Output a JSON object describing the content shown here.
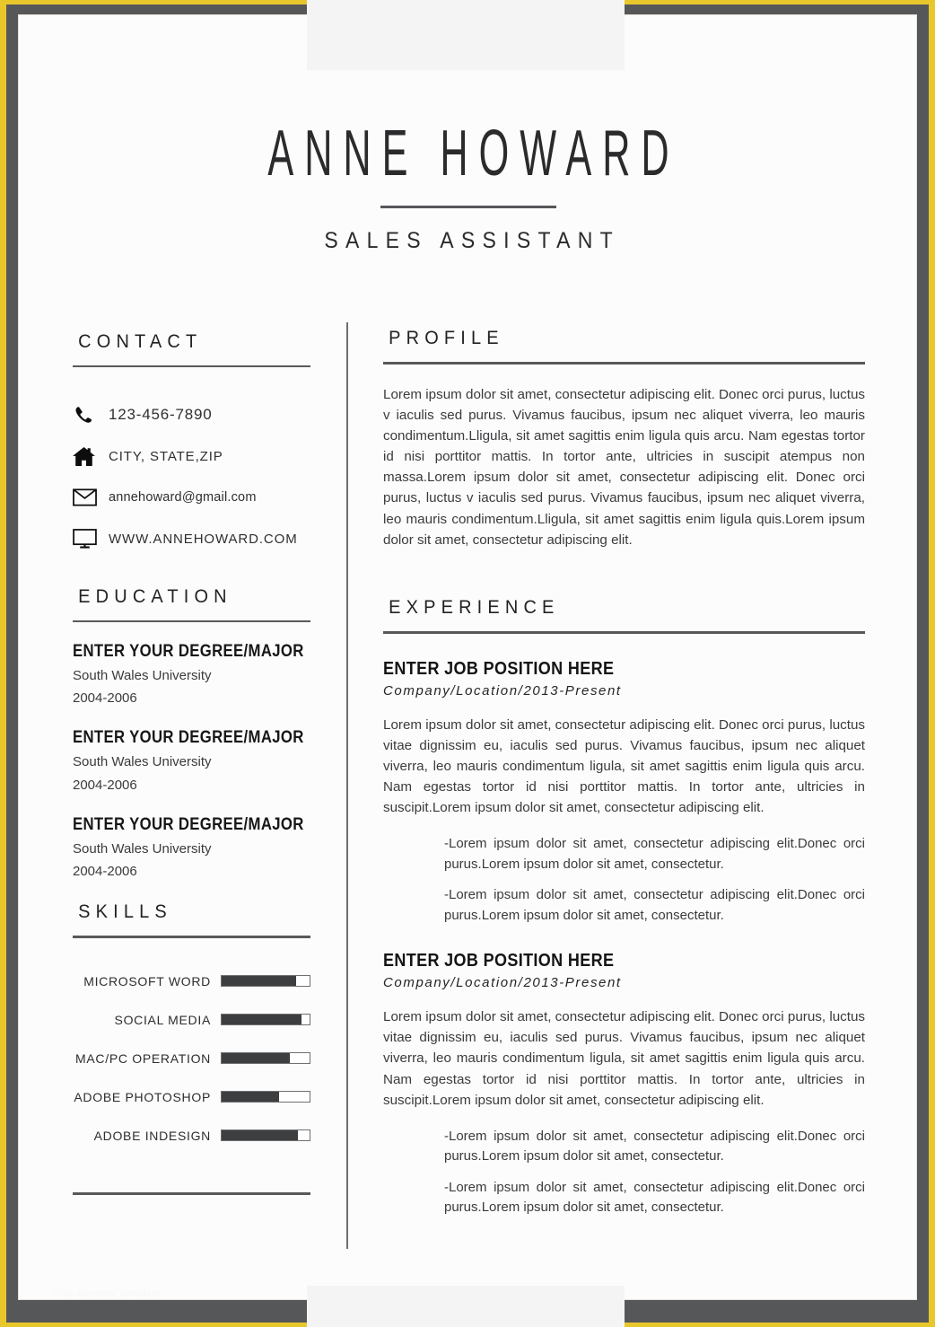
{
  "theme": {
    "gold": "#e8c72c",
    "frame_dark": "#565759",
    "paper": "#fcfcfc",
    "ink": "#2b2b2d",
    "bar_fill": "#3d3e40"
  },
  "header": {
    "name": "ANNE HOWARD",
    "job_title": "SALES ASSISTANT"
  },
  "contact": {
    "heading": "CONTACT",
    "items": [
      {
        "icon": "phone-icon",
        "value": "123-456-7890"
      },
      {
        "icon": "home-icon",
        "value": "CITY, STATE,ZIP"
      },
      {
        "icon": "envelope-icon",
        "value": "annehoward@gmail.com"
      },
      {
        "icon": "monitor-icon",
        "value": "WWW.ANNEHOWARD.COM"
      }
    ]
  },
  "education": {
    "heading": "EDUCATION",
    "items": [
      {
        "degree": "ENTER YOUR DEGREE/MAJOR",
        "school": "South Wales University",
        "years": "2004-2006"
      },
      {
        "degree": "ENTER YOUR DEGREE/MAJOR",
        "school": "South Wales University",
        "years": "2004-2006"
      },
      {
        "degree": "ENTER YOUR DEGREE/MAJOR",
        "school": "South Wales University",
        "years": "2004-2006"
      }
    ]
  },
  "skills": {
    "heading": "SKILLS",
    "items": [
      {
        "label": "MICROSOFT WORD",
        "level": 85
      },
      {
        "label": "SOCIAL MEDIA",
        "level": 91
      },
      {
        "label": "MAC/PC OPERATION",
        "level": 78
      },
      {
        "label": "ADOBE PHOTOSHOP",
        "level": 65
      },
      {
        "label": "ADOBE INDESIGN",
        "level": 87
      }
    ]
  },
  "profile": {
    "heading": "PROFILE",
    "text": "Lorem ipsum dolor sit amet, consectetur adipiscing elit. Donec orci purus, luctus v iaculis sed purus. Vivamus faucibus, ipsum nec aliquet viverra, leo mauris condimentum.Lligula, sit amet sagittis enim ligula quis arcu. Nam egestas tortor id nisi porttitor mattis. In tortor ante, ultricies in suscipit atempus non massa.Lorem ipsum dolor sit amet, consectetur adipiscing elit. Donec orci purus, luctus v iaculis sed purus. Vivamus faucibus, ipsum nec aliquet viverra, leo mauris condimentum.Lligula, sit amet sagittis enim ligula quis.Lorem ipsum dolor sit amet, consectetur adipiscing elit."
  },
  "experience": {
    "heading": "EXPERIENCE",
    "jobs": [
      {
        "title": "ENTER JOB POSITION HERE",
        "meta": "Company/Location/2013-Present",
        "description": "Lorem ipsum dolor sit amet, consectetur adipiscing elit. Donec orci purus, luctus vitae dignissim eu, iaculis sed purus. Vivamus faucibus, ipsum nec aliquet viverra, leo mauris condimentum ligula, sit amet sagittis enim ligula quis arcu. Nam egestas tortor id nisi porttitor mattis. In tortor ante, ultricies in suscipit.Lorem ipsum dolor sit amet, consectetur adipiscing elit.",
        "bullets": [
          "-Lorem ipsum dolor sit amet, consectetur adipiscing elit.Donec orci purus.Lorem ipsum dolor sit amet, consectetur.",
          "-Lorem ipsum dolor sit amet, consectetur adipiscing elit.Donec orci purus.Lorem ipsum dolor sit amet, consectetur."
        ]
      },
      {
        "title": "ENTER JOB POSITION HERE",
        "meta": "Company/Location/2013-Present",
        "description": "Lorem ipsum dolor sit amet, consectetur adipiscing elit. Donec orci purus, luctus vitae dignissim eu, iaculis sed purus. Vivamus faucibus, ipsum nec aliquet viverra, leo mauris condimentum ligula, sit amet sagittis enim ligula quis arcu. Nam egestas tortor id nisi porttitor mattis. In tortor ante, ultricies in suscipit.Lorem ipsum dolor sit amet, consectetur adipiscing elit.",
        "bullets": [
          "-Lorem ipsum dolor sit amet, consectetur adipiscing elit.Donec orci purus.Lorem ipsum dolor sit amet, consectetur.",
          "-Lorem ipsum dolor sit amet, consectetur adipiscing elit.Donec orci purus.Lorem ipsum dolor sit amet, consectetur."
        ]
      }
    ]
  },
  "watermark": "Free Resume Template"
}
